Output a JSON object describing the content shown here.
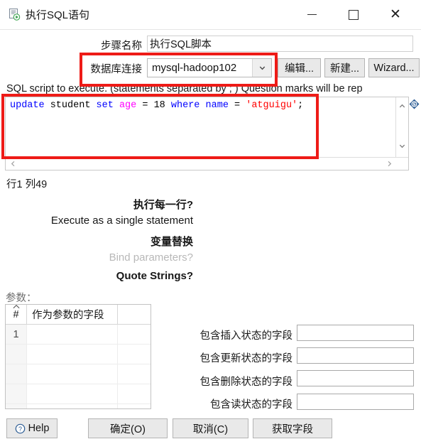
{
  "window": {
    "title": "执行SQL语句",
    "app_icon": "sql-script-icon",
    "controls": {
      "minimize": "minimize-icon",
      "maximize": "maximize-icon",
      "close": "close-icon"
    }
  },
  "form": {
    "step_name_label": "步骤名称",
    "step_name_value": "执行SQL脚本",
    "step_name_placeholder": "",
    "connection_label": "数据库连接",
    "connection_value": "mysql-hadoop102",
    "connection_options": [
      "mysql-hadoop102"
    ],
    "edit_button": "编辑...",
    "new_button": "新建...",
    "wizard_button": "Wizard..."
  },
  "sql": {
    "description": "SQL script to execute. (statements separated by ; ) Question marks will be rep",
    "tokens": [
      {
        "text": "update",
        "kind": "kw"
      },
      {
        "text": " student ",
        "kind": "plain"
      },
      {
        "text": "set",
        "kind": "kw"
      },
      {
        "text": " ",
        "kind": "plain"
      },
      {
        "text": "age",
        "kind": "col-mag"
      },
      {
        "text": " = ",
        "kind": "plain"
      },
      {
        "text": "18",
        "kind": "num"
      },
      {
        "text": " ",
        "kind": "plain"
      },
      {
        "text": "where",
        "kind": "kw"
      },
      {
        "text": " ",
        "kind": "plain"
      },
      {
        "text": "name",
        "kind": "kw"
      },
      {
        "text": " = ",
        "kind": "plain"
      },
      {
        "text": "'atguigu'",
        "kind": "str"
      },
      {
        "text": ";",
        "kind": "plain"
      }
    ],
    "full_text": "update student set age = 18 where name = 'atguigu';",
    "variable_icon": "variable-diamond-icon",
    "scroll_up_icon": "chevron-up-icon",
    "scroll_down_icon": "chevron-down-icon",
    "scroll_left_icon": "chevron-left-icon",
    "scroll_right_icon": "chevron-right-icon",
    "cursor_position": "行1 列49"
  },
  "options": [
    {
      "label": "执行每一行?",
      "disabled": false
    },
    {
      "label": "Execute as a single statement",
      "disabled": false
    },
    {
      "label": "变量替换",
      "disabled": false
    },
    {
      "label": "Bind parameters?",
      "disabled": true
    },
    {
      "label": "Quote Strings?",
      "disabled": false
    }
  ],
  "parameters": {
    "section_label": "参数：",
    "columns": [
      "#",
      "作为参数的字段",
      ""
    ],
    "sort_indicator": "sort-ascending-icon",
    "rows": [
      [
        "1",
        "",
        ""
      ],
      [
        "",
        "",
        ""
      ],
      [
        "",
        "",
        ""
      ],
      [
        "",
        "",
        ""
      ],
      [
        "",
        "",
        ""
      ]
    ]
  },
  "status_fields": [
    {
      "label": "包含插入状态的字段",
      "value": ""
    },
    {
      "label": "包含更新状态的字段",
      "value": ""
    },
    {
      "label": "包含删除状态的字段",
      "value": ""
    },
    {
      "label": "包含读状态的字段",
      "value": ""
    }
  ],
  "footer": {
    "help_label": "Help",
    "help_icon": "question-circle-icon",
    "ok_label": "确定(O)",
    "cancel_label": "取消(C)",
    "get_fields_label": "获取字段"
  },
  "annotations": {
    "color": "#ee1b17",
    "boxes": [
      "connection-row-highlight",
      "sql-editor-highlight"
    ]
  }
}
